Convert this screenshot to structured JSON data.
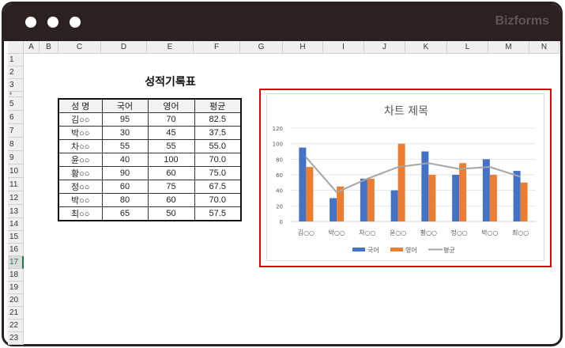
{
  "window": {
    "brand": "Bizforms"
  },
  "sheet": {
    "columns": [
      "A",
      "B",
      "C",
      "D",
      "E",
      "F",
      "G",
      "H",
      "I",
      "J",
      "K",
      "L",
      "M",
      "N"
    ],
    "rows": [
      "1",
      "2",
      "3",
      "4",
      "5",
      "6",
      "7",
      "8",
      "9",
      "10",
      "11",
      "12",
      "13",
      "14",
      "15",
      "16",
      "17",
      "18",
      "19",
      "20",
      "21",
      "22",
      "23"
    ],
    "selected_row": "17",
    "title": "성적기록표"
  },
  "table": {
    "headers": [
      "성 명",
      "국어",
      "영어",
      "평균"
    ],
    "rows": [
      [
        "김○○",
        "95",
        "70",
        "82.5"
      ],
      [
        "박○○",
        "30",
        "45",
        "37.5"
      ],
      [
        "차○○",
        "55",
        "55",
        "55.0"
      ],
      [
        "윤○○",
        "40",
        "100",
        "70.0"
      ],
      [
        "황○○",
        "90",
        "60",
        "75.0"
      ],
      [
        "정○○",
        "60",
        "75",
        "67.5"
      ],
      [
        "박○○",
        "80",
        "60",
        "70.0"
      ],
      [
        "최○○",
        "65",
        "50",
        "57.5"
      ]
    ]
  },
  "chart_data": {
    "type": "bar",
    "title": "차트 제목",
    "categories": [
      "김○○",
      "박○○",
      "차○○",
      "윤○○",
      "황○○",
      "정○○",
      "박○○",
      "최○○"
    ],
    "series": [
      {
        "name": "국어",
        "type": "bar",
        "color": "#4472c4",
        "values": [
          95,
          30,
          55,
          40,
          90,
          60,
          80,
          65
        ]
      },
      {
        "name": "영어",
        "type": "bar",
        "color": "#ed7d31",
        "values": [
          70,
          45,
          55,
          100,
          60,
          75,
          60,
          50
        ]
      },
      {
        "name": "평균",
        "type": "line",
        "color": "#a5a5a5",
        "values": [
          82.5,
          37.5,
          55,
          70,
          75,
          67.5,
          70,
          57.5
        ]
      }
    ],
    "yticks": [
      "0",
      "20",
      "40",
      "60",
      "80",
      "100",
      "120"
    ],
    "ylim": [
      0,
      120
    ],
    "grid": true,
    "legend": "bottom"
  }
}
